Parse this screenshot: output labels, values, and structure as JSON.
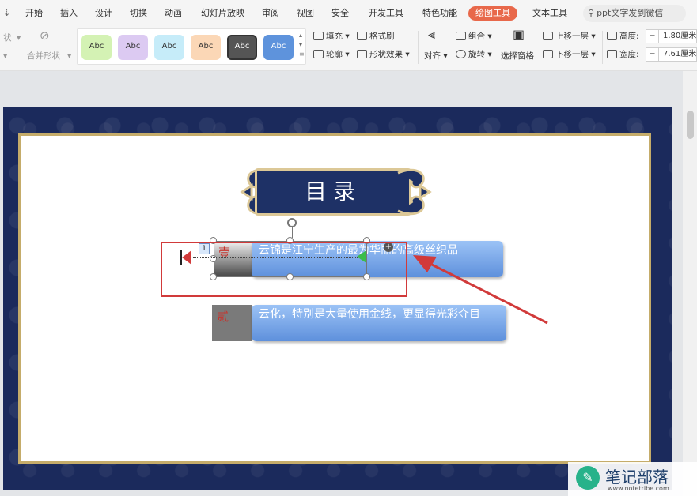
{
  "menu": {
    "items": [
      "开始",
      "插入",
      "设计",
      "切换",
      "动画",
      "幻灯片放映",
      "审阅",
      "视图",
      "安全",
      "开发工具",
      "特色功能",
      "绘图工具",
      "文本工具"
    ],
    "active": "绘图工具",
    "search_placeholder": "ppt文字发到微信"
  },
  "ribbon": {
    "shape_label": "状",
    "merge_label": "合并形状",
    "style_swatches": [
      "Abc",
      "Abc",
      "Abc",
      "Abc",
      "Abc",
      "Abc"
    ],
    "swatch_colors": [
      "#d4f2b4",
      "#dccaf2",
      "#c6ecf9",
      "#fbd7b6",
      "#555555",
      "#5e93dc"
    ],
    "fill": "填充",
    "format_painter": "格式刷",
    "outline": "轮廓",
    "shape_effects": "形状效果",
    "align": "对齐",
    "group": "组合",
    "rotate": "旋转",
    "selection_pane": "选择窗格",
    "bring_forward": "上移一层",
    "send_backward": "下移一层",
    "height_label": "高度:",
    "height_value": "1.80厘米",
    "width_label": "宽度:",
    "width_value": "7.61厘米"
  },
  "slide": {
    "title": "目录",
    "items": [
      {
        "num": "壹",
        "text": "云锦是江宁生产的最为华丽的高级丝织品"
      },
      {
        "num": "贰",
        "text": "云化，特别是大量使用金线，更显得光彩夺目"
      }
    ],
    "selection_tag": "1"
  },
  "watermark": {
    "name": "笔记部落",
    "url": "www.notetribe.com"
  },
  "colors": {
    "accent": "#e8684a",
    "annotation_red": "#d13a3a",
    "slide_navy": "#1b2a5c",
    "gold": "#c5ac6a"
  }
}
